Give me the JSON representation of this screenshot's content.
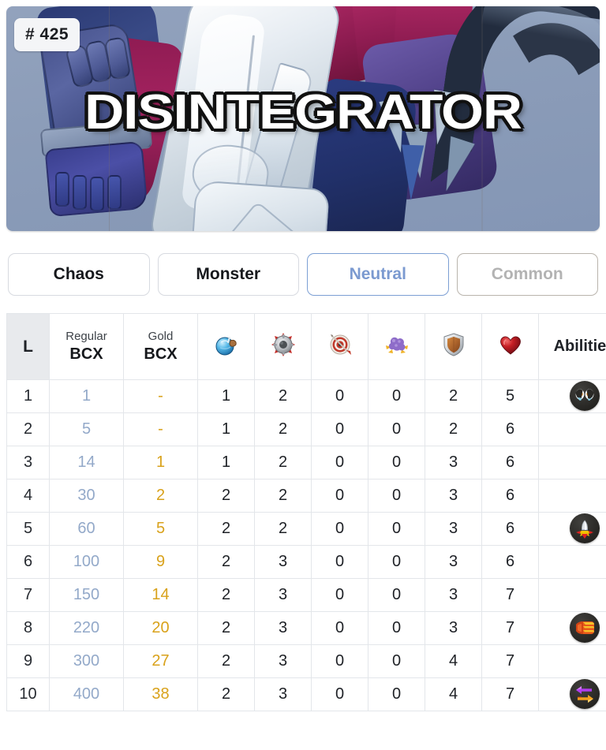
{
  "card": {
    "id_badge": "# 425",
    "name": "DISINTEGRATOR"
  },
  "attributes": [
    {
      "label": "Chaos",
      "style": "default",
      "name": "edition"
    },
    {
      "label": "Monster",
      "style": "default",
      "name": "card-type"
    },
    {
      "label": "Neutral",
      "style": "accent",
      "name": "splinter"
    },
    {
      "label": "Common",
      "style": "muted",
      "name": "rarity"
    }
  ],
  "colors": {
    "accent": "#7b9ad0",
    "muted": "#b3b3b3",
    "regular_bcx": "#93a9c9",
    "gold_bcx": "#d9a21b",
    "level_cell_bg": "#e8eaed"
  },
  "table": {
    "headers": {
      "level": "L",
      "regular_bcx_sub": "Regular",
      "regular_bcx_main": "BCX",
      "gold_bcx_sub": "Gold",
      "gold_bcx_main": "BCX",
      "abilities": "Abilities"
    },
    "stat_icons": [
      {
        "name": "mana-icon",
        "glyph": "mana"
      },
      {
        "name": "attack-icon",
        "glyph": "melee"
      },
      {
        "name": "ranged-icon",
        "glyph": "ranged"
      },
      {
        "name": "magic-icon",
        "glyph": "magic"
      },
      {
        "name": "armor-icon",
        "glyph": "armor"
      },
      {
        "name": "health-icon",
        "glyph": "health"
      }
    ],
    "rows": [
      {
        "level": "1",
        "regular_bcx": "1",
        "gold_bcx": "-",
        "mana": "1",
        "melee": "2",
        "ranged": "0",
        "magic": "0",
        "armor": "2",
        "health": "5",
        "ability": "sneak-eyes-icon"
      },
      {
        "level": "2",
        "regular_bcx": "5",
        "gold_bcx": "-",
        "mana": "1",
        "melee": "2",
        "ranged": "0",
        "magic": "0",
        "armor": "2",
        "health": "6",
        "ability": ""
      },
      {
        "level": "3",
        "regular_bcx": "14",
        "gold_bcx": "1",
        "mana": "1",
        "melee": "2",
        "ranged": "0",
        "magic": "0",
        "armor": "3",
        "health": "6",
        "ability": ""
      },
      {
        "level": "4",
        "regular_bcx": "30",
        "gold_bcx": "2",
        "mana": "2",
        "melee": "2",
        "ranged": "0",
        "magic": "0",
        "armor": "3",
        "health": "6",
        "ability": ""
      },
      {
        "level": "5",
        "regular_bcx": "60",
        "gold_bcx": "5",
        "mana": "2",
        "melee": "2",
        "ranged": "0",
        "magic": "0",
        "armor": "3",
        "health": "6",
        "ability": "piercing-blade-icon"
      },
      {
        "level": "6",
        "regular_bcx": "100",
        "gold_bcx": "9",
        "mana": "2",
        "melee": "3",
        "ranged": "0",
        "magic": "0",
        "armor": "3",
        "health": "6",
        "ability": ""
      },
      {
        "level": "7",
        "regular_bcx": "150",
        "gold_bcx": "14",
        "mana": "2",
        "melee": "3",
        "ranged": "0",
        "magic": "0",
        "armor": "3",
        "health": "7",
        "ability": ""
      },
      {
        "level": "8",
        "regular_bcx": "220",
        "gold_bcx": "20",
        "mana": "2",
        "melee": "3",
        "ranged": "0",
        "magic": "0",
        "armor": "3",
        "health": "7",
        "ability": "fist-icon"
      },
      {
        "level": "9",
        "regular_bcx": "300",
        "gold_bcx": "27",
        "mana": "2",
        "melee": "3",
        "ranged": "0",
        "magic": "0",
        "armor": "4",
        "health": "7",
        "ability": ""
      },
      {
        "level": "10",
        "regular_bcx": "400",
        "gold_bcx": "38",
        "mana": "2",
        "melee": "3",
        "ranged": "0",
        "magic": "0",
        "armor": "4",
        "health": "7",
        "ability": "opposing-arrows-icon"
      }
    ]
  }
}
